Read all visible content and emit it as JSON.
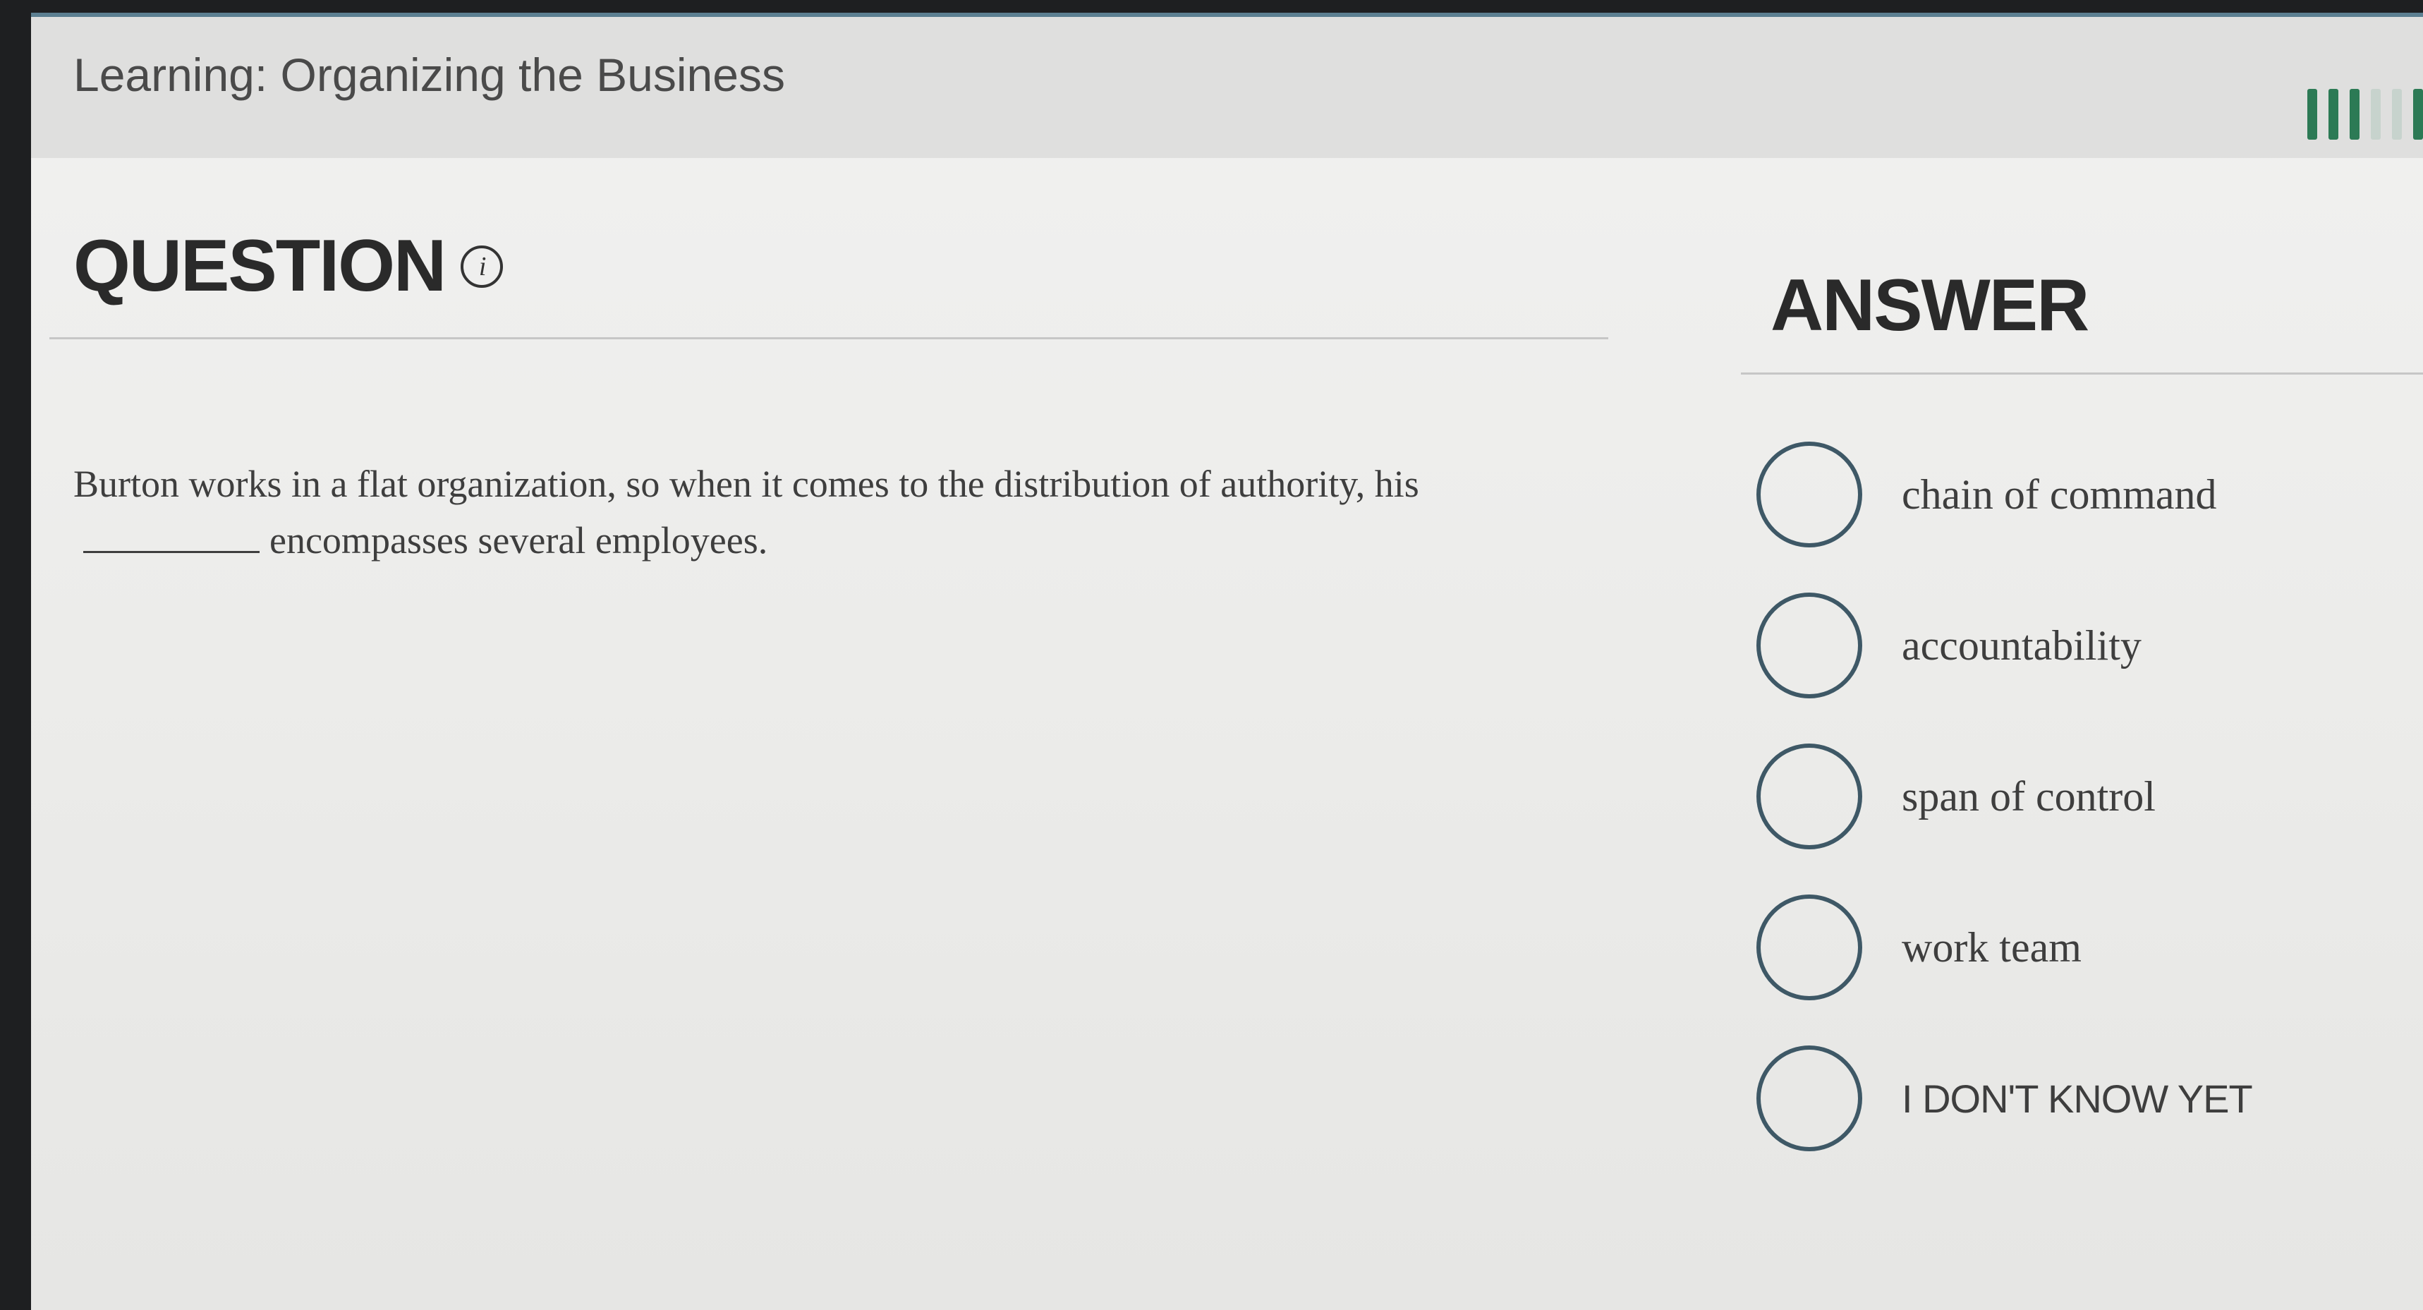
{
  "header": {
    "title": "Learning: Organizing the Business",
    "progress": {
      "filled": 3,
      "total": 6
    }
  },
  "question": {
    "heading": "QUESTION",
    "info_icon": "info-icon",
    "text_before": "Burton works in a flat organization, so when it comes to the distribution of authority, his",
    "text_after": "encompasses several employees."
  },
  "answer": {
    "heading": "ANSWER",
    "options": [
      {
        "label": "chain of command"
      },
      {
        "label": "accountability"
      },
      {
        "label": "span of control"
      },
      {
        "label": "work team"
      },
      {
        "label": "I DON'T KNOW YET"
      }
    ]
  },
  "colors": {
    "accent": "#2c7a55",
    "radio_border": "#3e5866",
    "top_rule": "#5c7f91"
  }
}
